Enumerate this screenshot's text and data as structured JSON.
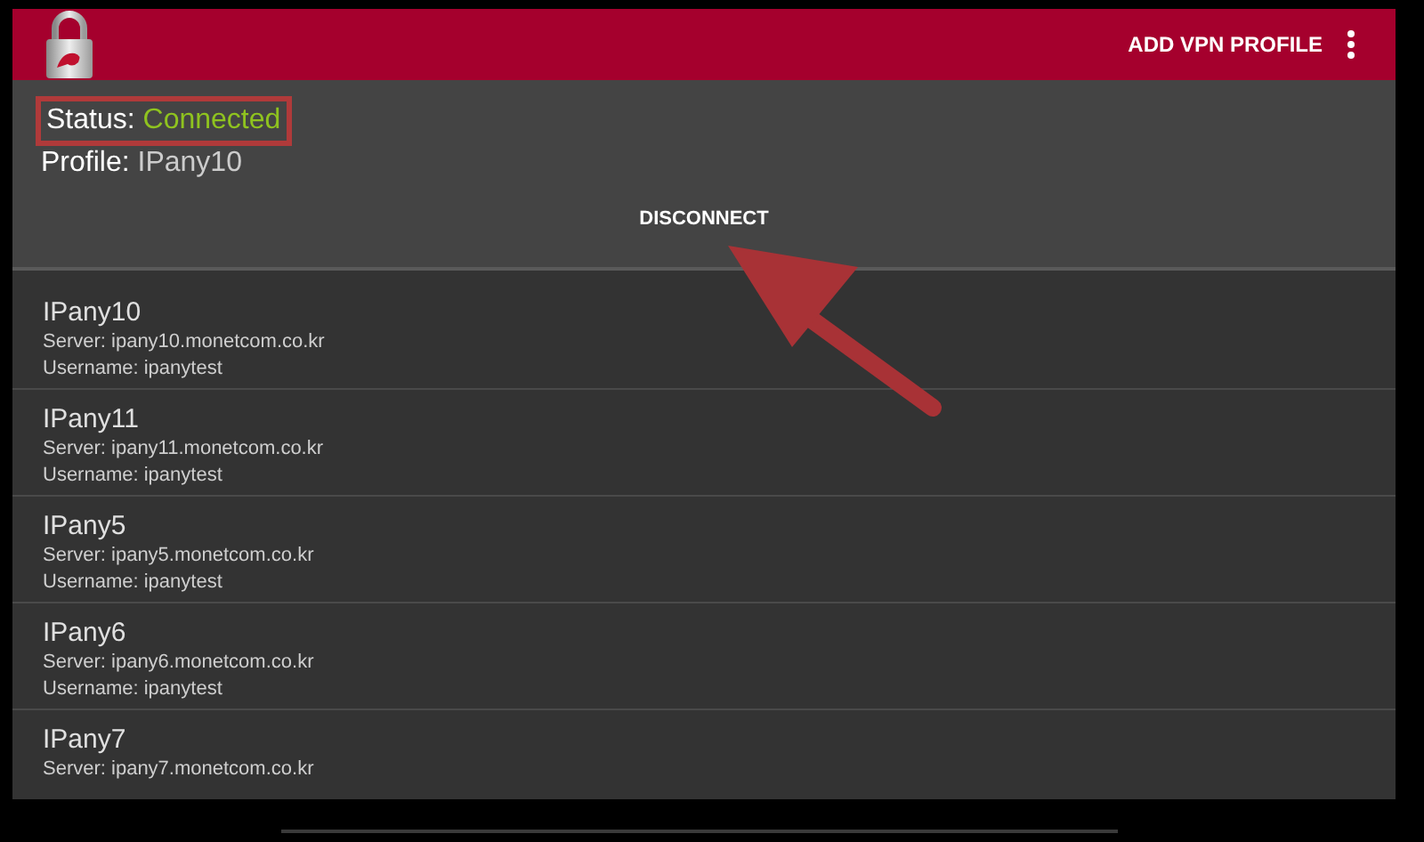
{
  "app_bar": {
    "action": "ADD VPN PROFILE"
  },
  "status": {
    "label": "Status:",
    "value": "Connected",
    "highlighted": true
  },
  "profile": {
    "label": "Profile:",
    "value": "IPany10"
  },
  "disconnect_button": "DISCONNECT",
  "annotation": {
    "kind": "arrow"
  },
  "profiles": [
    {
      "name": "IPany10",
      "server": "Server: ipany10.monetcom.co.kr",
      "username": "Username: ipanytest"
    },
    {
      "name": "IPany11",
      "server": "Server: ipany11.monetcom.co.kr",
      "username": "Username: ipanytest"
    },
    {
      "name": "IPany5",
      "server": "Server: ipany5.monetcom.co.kr",
      "username": "Username: ipanytest"
    },
    {
      "name": "IPany6",
      "server": "Server: ipany6.monetcom.co.kr",
      "username": "Username: ipanytest"
    },
    {
      "name": "IPany7",
      "server": "Server: ipany7.monetcom.co.kr"
    }
  ]
}
